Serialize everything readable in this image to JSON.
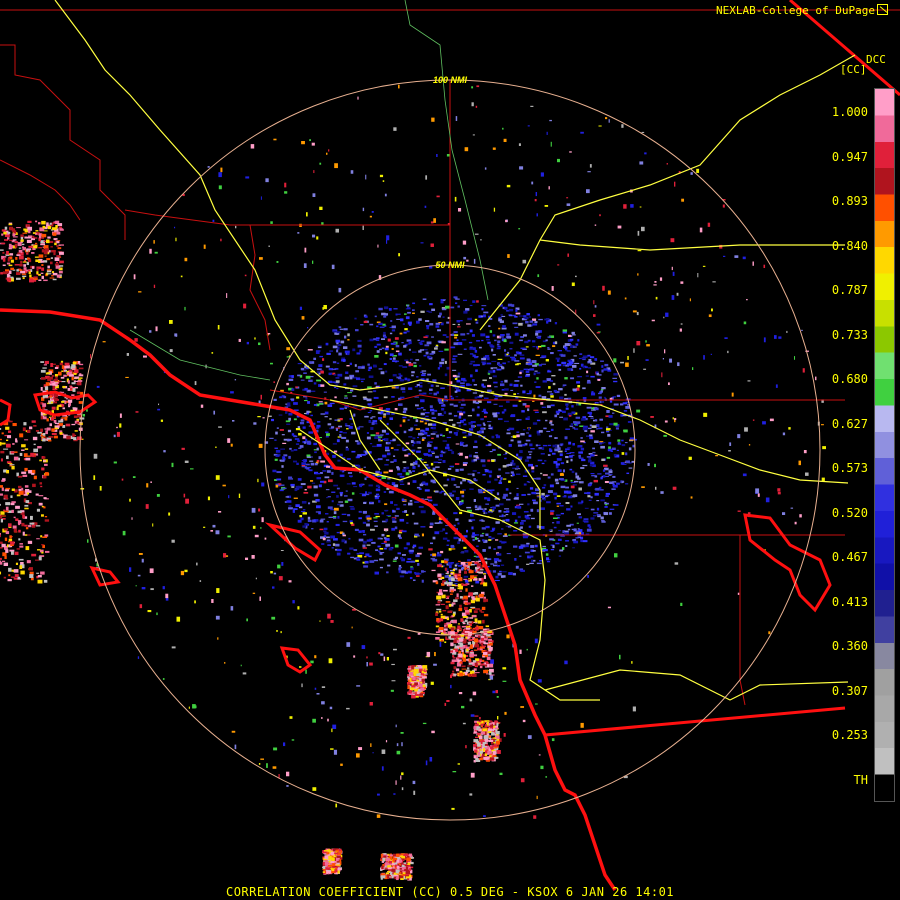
{
  "credit": "NEXLAB-College of DuPage",
  "credit_icon": "link-out-icon",
  "product_code": "DCC",
  "product_unit": "[CC]",
  "range_rings": [
    "100 NMI",
    "50 NMI"
  ],
  "footer": "CORRELATION COEFFICIENT (CC) 0.5 DEG - KSOX 6 JAN 26 14:01",
  "legend": {
    "labels": [
      "1.000",
      "0.947",
      "0.893",
      "0.840",
      "0.787",
      "0.733",
      "0.680",
      "0.627",
      "0.573",
      "0.520",
      "0.467",
      "0.413",
      "0.360",
      "0.307",
      "0.253",
      "TH"
    ],
    "colors": [
      "#ff9ec8",
      "#f06a9a",
      "#e0203a",
      "#b0141e",
      "#ff5000",
      "#ff9a00",
      "#ffd800",
      "#f0f000",
      "#c8e000",
      "#8cc800",
      "#70e070",
      "#40d040",
      "#b8b8f0",
      "#9090e0",
      "#6060d8",
      "#3030e0",
      "#2020d8",
      "#1818c0",
      "#1010a8",
      "#202090",
      "#4040a0",
      "#8888a0",
      "#a0a0a0",
      "#a8a8a8",
      "#b0b0b0",
      "#c0c0c0",
      "#000000"
    ]
  },
  "colors": {
    "state_border": "#d01010",
    "coast": "#ff1010",
    "highway": "#ffff40",
    "range_ring": "#e8b090",
    "label": "#ffff00"
  }
}
